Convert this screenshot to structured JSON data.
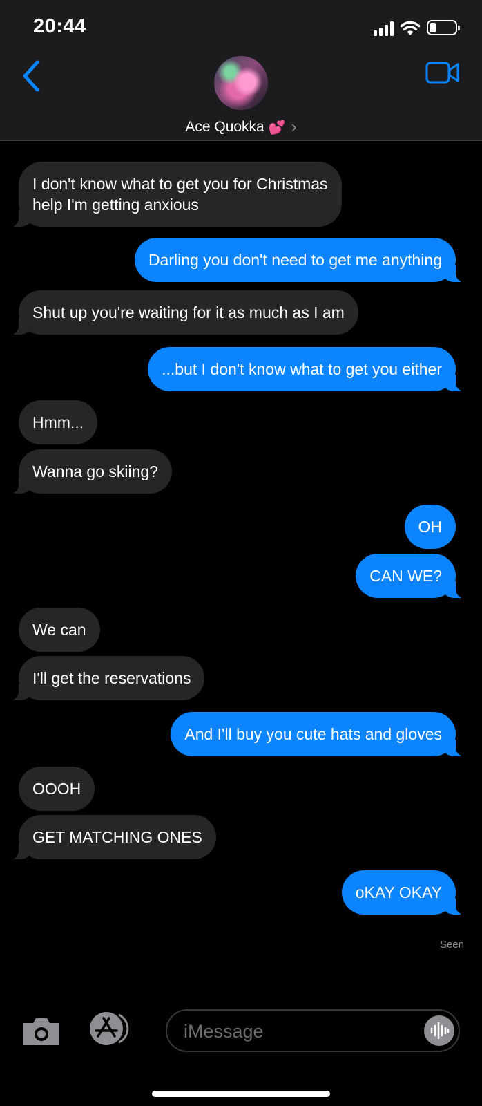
{
  "status_bar": {
    "time": "20:44"
  },
  "contact": {
    "name": "Ace Quokka",
    "emoji": "💕",
    "chevron": "›"
  },
  "messages": [
    {
      "side": "in",
      "lines": [
        "I don't know what to get you for Christmas",
        "help I'm getting anxious"
      ]
    },
    {
      "side": "out",
      "lines": [
        "Darling you don't need to get me anything"
      ]
    },
    {
      "side": "in",
      "lines": [
        "Shut up you're waiting for it as much as I am"
      ]
    },
    {
      "side": "out",
      "lines": [
        "...but I don't know what to get you either"
      ]
    },
    {
      "side": "in",
      "lines": [
        "Hmm..."
      ]
    },
    {
      "side": "in",
      "lines": [
        "Wanna go skiing?"
      ]
    },
    {
      "side": "out",
      "lines": [
        "OH"
      ]
    },
    {
      "side": "out",
      "lines": [
        "CAN WE?"
      ]
    },
    {
      "side": "in",
      "lines": [
        "We can"
      ]
    },
    {
      "side": "in",
      "lines": [
        "I'll get the reservations"
      ]
    },
    {
      "side": "out",
      "lines": [
        "And I'll buy you cute hats and gloves"
      ]
    },
    {
      "side": "in",
      "lines": [
        "OOOH"
      ]
    },
    {
      "side": "in",
      "lines": [
        "GET MATCHING ONES"
      ]
    },
    {
      "side": "out",
      "lines": [
        "oKAY OKAY"
      ]
    }
  ],
  "read_receipt": "Seen",
  "composer": {
    "placeholder": "iMessage"
  },
  "icons": {
    "back": "chevron-left-icon",
    "video": "video-camera-icon",
    "camera": "camera-icon",
    "apps": "app-store-icon",
    "audio": "audio-waveform-icon"
  },
  "colors": {
    "outgoing": "#0b84fe",
    "incoming": "#262629",
    "accent": "#0a84ff"
  }
}
